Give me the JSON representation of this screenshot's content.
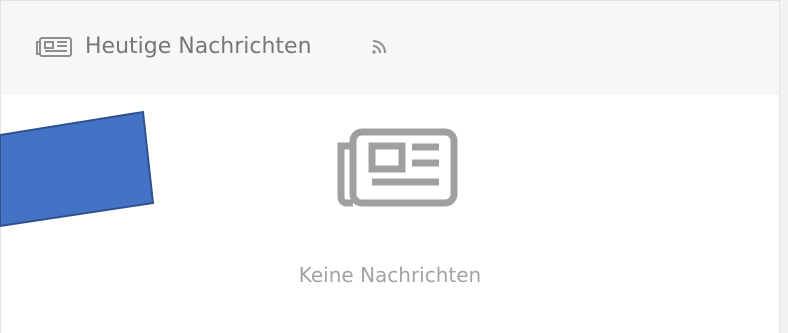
{
  "widget": {
    "title": "Heutige Nachrichten",
    "header_icon": "newspaper-icon",
    "feed_icon": "rss-icon"
  },
  "empty_state": {
    "icon": "newspaper-icon",
    "message": "Keine Nachrichten"
  },
  "annotation": {
    "shape": "blue-parallelogram",
    "fill": "#4472c4",
    "stroke": "#2f528f"
  },
  "colors": {
    "header_background": "#f7f7f7",
    "title_text": "#777777",
    "muted_icon": "#9b9b9b",
    "empty_text": "#a3a3a3"
  }
}
